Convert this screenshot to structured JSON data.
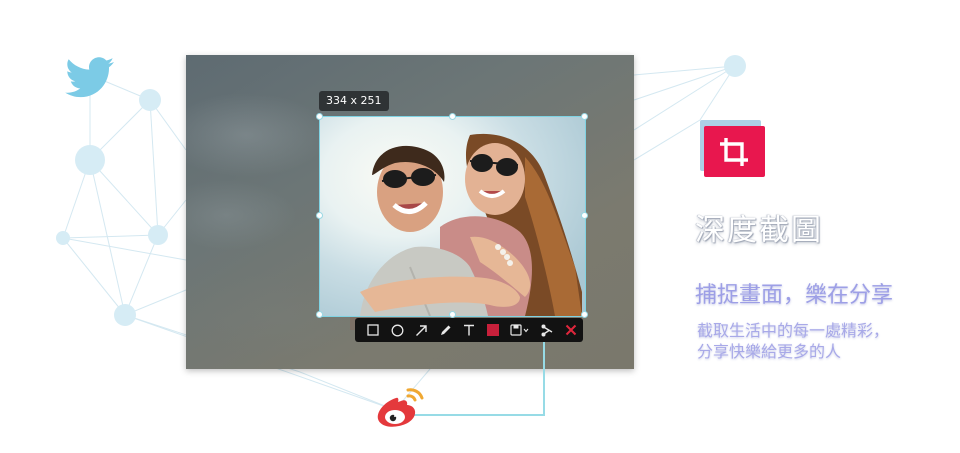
{
  "selection": {
    "size_label": "334 x 251"
  },
  "toolbar": {
    "tools": [
      {
        "icon": "rectangle-icon"
      },
      {
        "icon": "ellipse-icon"
      },
      {
        "icon": "arrow-icon"
      },
      {
        "icon": "pencil-icon"
      },
      {
        "icon": "text-icon"
      },
      {
        "icon": "color-swatch-icon",
        "color": "#c8203b"
      },
      {
        "icon": "save-icon"
      },
      {
        "icon": "share-icon"
      },
      {
        "icon": "close-icon",
        "color": "#e0263c"
      }
    ]
  },
  "feature": {
    "title": "深度截圖",
    "subtitle": "捕捉畫面，樂在分享",
    "description_lines": [
      "截取生活中的每一處精彩，",
      "分享快樂給更多的人"
    ]
  },
  "colors": {
    "accent_red": "#e8174e",
    "selection_border": "#7fd3e3",
    "text_purple": "#9d9fe6",
    "connector": "#97dbe6"
  },
  "icons": {
    "twitter": "twitter-icon",
    "weibo": "weibo-icon",
    "crop": "crop-icon"
  }
}
